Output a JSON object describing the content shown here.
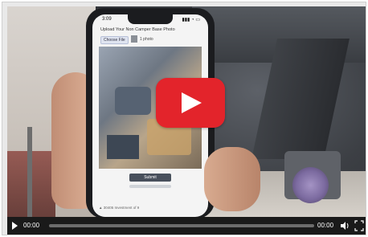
{
  "phone_screen": {
    "status_time": "3:09",
    "status_icons": "▮▮▮ ◔ ▭",
    "upload_title": "Upload Your Non Camper Base Photo",
    "choose_file_label": "Choose File",
    "photo_count": "1 photo",
    "submit_label": "Submit",
    "footer_text": "▲ 30405 Investment of 9"
  },
  "player": {
    "current_time": "00:00",
    "duration": "00:00",
    "progress": 0,
    "colors": {
      "play_button": "#e3242b",
      "control_bar": "#1a1a1a"
    },
    "icons": [
      "play-icon",
      "volume-icon",
      "fullscreen-icon",
      "big-play-icon"
    ]
  }
}
